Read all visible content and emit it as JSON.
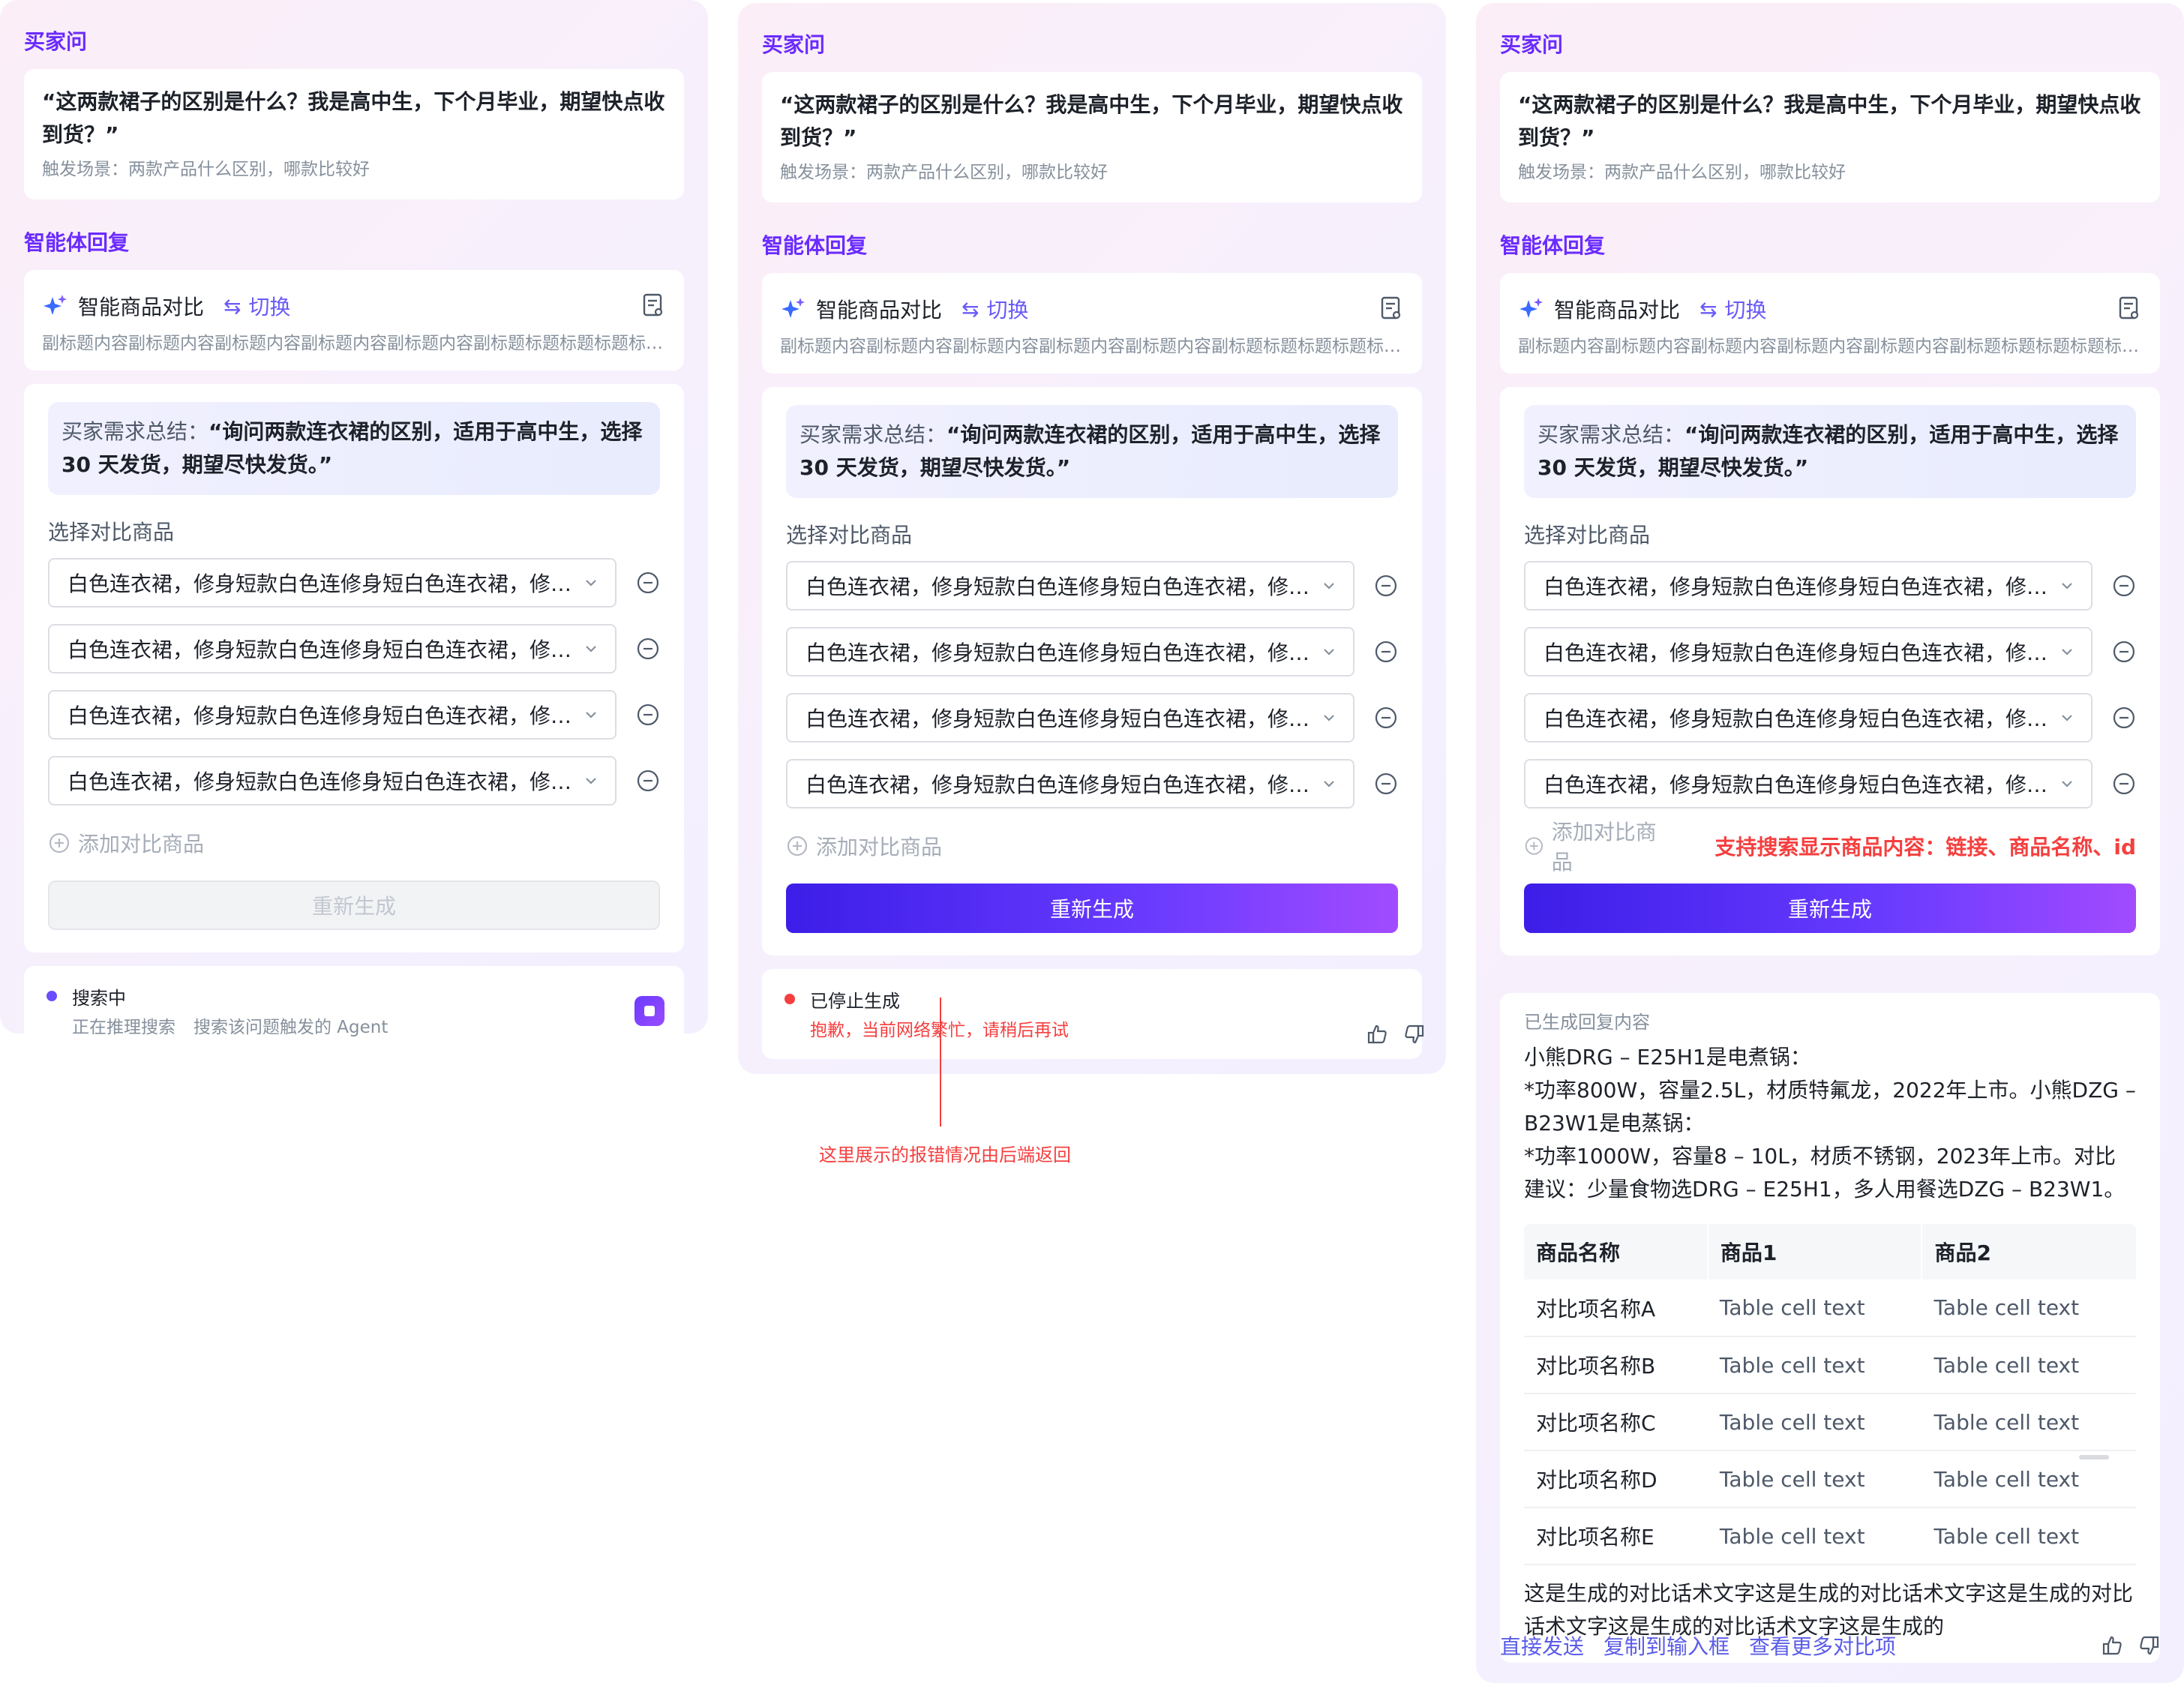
{
  "buyer_label": "买家问",
  "agent_label": "智能体回复",
  "question": "“这两款裙子的区别是什么？我是高中生，下个月毕业，期望快点收到货？”",
  "trigger": "触发场景：两款产品什么区别，哪款比较好",
  "agent": {
    "name": "智能商品对比",
    "switch_label": "切换",
    "subtitle": "副标题内容副标题内容副标题内容副标题内容副标题内容副标题标题标题标题标题..."
  },
  "summary": {
    "label": "买家需求总结：",
    "value": "“询问两款连衣裙的区别，适用于高中生，选择 30 天发货，期望尽快发货。”"
  },
  "select_label": "选择对比商品",
  "products": [
    "白色连衣裙，修身短款白色连修身短白色连衣裙，修身短款白色连衣裙",
    "白色连衣裙，修身短款白色连修身短白色连衣裙，修身短款白色连衣裙",
    "白色连衣裙，修身短款白色连修身短白色连衣裙，修身短款白色连衣裙",
    "白色连衣裙，修身短款白色连修身短白色连衣裙，修身短款白色连衣裙"
  ],
  "add_label": "添加对比商品",
  "regen_label": "重新生成",
  "panel1_status": {
    "title": "搜索中",
    "sub1": "正在推理搜索",
    "sub2": "搜索该问题触发的 Agent"
  },
  "panel2_status": {
    "title": "已停止生成",
    "error": "抱歉，当前网络繁忙，请稍后再试"
  },
  "annotation_error": "这里展示的报错情况由后端返回",
  "annotation_search": "支持搜索显示商品内容：链接、商品名称、id",
  "result": {
    "label": "已生成回复内容",
    "text": "小熊DRG – E25H1是电煮锅：\n*功率800W，容量2.5L，材质特氟龙，2022年上市。小熊DZG – B23W1是电蒸锅：\n*功率1000W，容量8 – 10L，材质不锈钢，2023年上市。对比建议：少量食物选DRG – E25H1，多人用餐选DZG – B23W1。",
    "table": {
      "headers": [
        "商品名称",
        "商品1",
        "商品2"
      ],
      "rows": [
        [
          "对比项名称A",
          "Table cell text",
          "Table cell text"
        ],
        [
          "对比项名称B",
          "Table cell text",
          "Table cell text"
        ],
        [
          "对比项名称C",
          "Table cell text",
          "Table cell text"
        ],
        [
          "对比项名称D",
          "Table cell text",
          "Table cell text"
        ],
        [
          "对比项名称E",
          "Table cell text",
          "Table cell text"
        ]
      ]
    },
    "closing": "这是生成的对比话术文字这是生成的对比话术文字这是生成的对比话术文字这是生成的对比话术文字这是生成的"
  },
  "actions": {
    "send": "直接发送",
    "copy": "复制到输入框",
    "more": "查看更多对比项"
  },
  "icons": {
    "spark": "sparkle-icon",
    "swap": "swap-icon",
    "doc": "document-icon",
    "chevron": "chevron-down-icon",
    "minus": "minus-circle-icon",
    "plus": "plus-circle-icon",
    "stop": "stop-icon",
    "like": "thumbs-up-icon",
    "dislike": "thumbs-down-icon"
  },
  "colors": {
    "accent": "#6a2bff",
    "button_gradient_start": "#3c1ee8",
    "button_gradient_end": "#a24bff",
    "error": "#f53f3f",
    "link": "#5b5ce8"
  }
}
